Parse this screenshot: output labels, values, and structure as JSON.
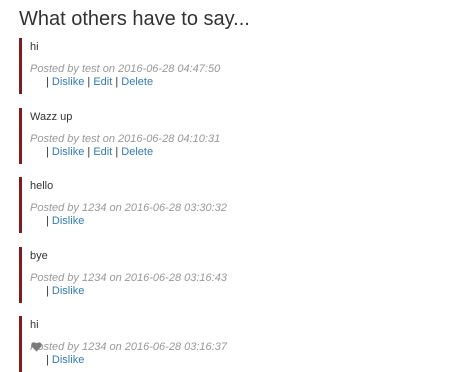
{
  "heading": "What others have to say...",
  "separator": "|",
  "comments": [
    {
      "text": "hi",
      "meta": "Posted by test on 2016-06-28 04:47:50",
      "dislike": "Dislike",
      "edit": "Edit",
      "delete": "Delete"
    },
    {
      "text": "Wazz up",
      "meta": "Posted by test on 2016-06-28 04:10:31",
      "dislike": "Dislike",
      "edit": "Edit",
      "delete": "Delete"
    },
    {
      "text": "hello",
      "meta": "Posted by 1234 on 2016-06-28 03:30:32",
      "dislike": "Dislike"
    },
    {
      "text": "bye",
      "meta": "Posted by 1234 on 2016-06-28 03:16:43",
      "dislike": "Dislike"
    },
    {
      "text": "hi",
      "meta": "Posted by 1234 on 2016-06-28 03:16:37",
      "dislike": "Dislike"
    }
  ],
  "colors": {
    "accent_border": "#7f1d1d",
    "link": "#337ab7",
    "meta_text": "#999999",
    "body_text": "#333333"
  },
  "icons": {
    "last_comment_overlay": "heart-icon"
  }
}
